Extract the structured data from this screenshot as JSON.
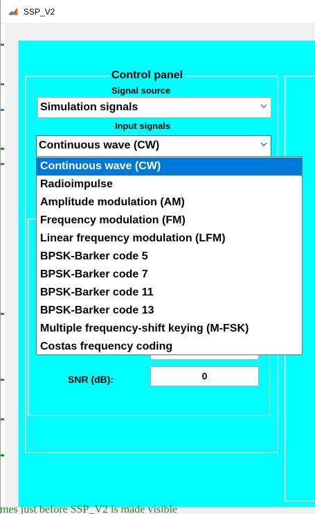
{
  "window": {
    "title": "SSP_V2",
    "icon": "matlab-figure-icon"
  },
  "background_text": "mes just before SSP_V2 is made visible",
  "control_panel": {
    "title": "Control panel",
    "signal_source_label": "Signal source",
    "signal_source_value": "Simulation signals",
    "input_signals_label": "Input signals",
    "input_signals_value": "Continuous wave (CW)",
    "snr_label": "SNR (dB):",
    "snr_value": "0"
  },
  "input_signal_options": [
    "Continuous wave (CW)",
    "Radioimpulse",
    "Amplitude modulation (AM)",
    "Frequency modulation (FM)",
    "Linear frequency modulation (LFM)",
    "BPSK-Barker code 5",
    "BPSK-Barker code 7",
    "BPSK-Barker code 11",
    "BPSK-Barker code 13",
    "Multiple frequency-shift keying (M-FSK)",
    "Costas frequency coding"
  ],
  "selected_option": "Continuous wave (CW)",
  "colors": {
    "panel": "#00ffff",
    "selection": "#0078d7"
  }
}
